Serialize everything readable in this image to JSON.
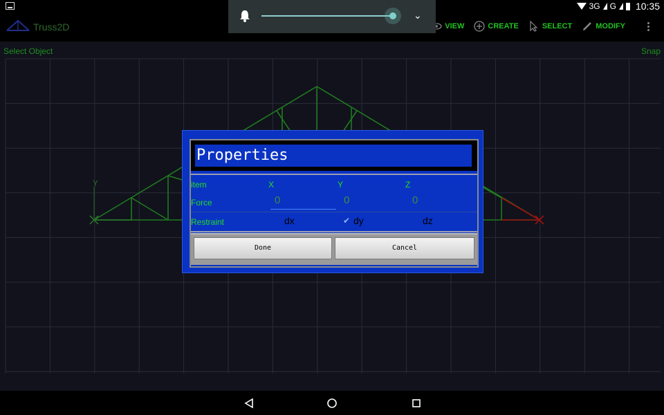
{
  "statusbar": {
    "network": "3G",
    "network2": "G",
    "time": "10:35"
  },
  "app": {
    "title": "Truss2D"
  },
  "menu": [
    {
      "icon": "eye-icon",
      "label": "VIEW"
    },
    {
      "icon": "plus-circle-icon",
      "label": "CREATE"
    },
    {
      "icon": "cursor-icon",
      "label": "SELECT"
    },
    {
      "icon": "pencil-icon",
      "label": "MODIFY"
    }
  ],
  "volume": {
    "level": 0.9
  },
  "canvas": {
    "status_left": "Select Object",
    "status_right": "Snap",
    "axis_y_label": "Y"
  },
  "dialog": {
    "title": "Properties",
    "header": {
      "label": "item",
      "x": "X",
      "y": "Y",
      "z": "Z"
    },
    "force": {
      "label": "Force",
      "x": "0",
      "y": "0",
      "z": "0"
    },
    "restraint": {
      "label": "Restraint",
      "dx": {
        "label": "dx",
        "checked": false
      },
      "dy": {
        "label": "dy",
        "checked": true
      },
      "dz": {
        "label": "dz",
        "checked": false
      }
    },
    "done_label": "Done",
    "cancel_label": "Cancel"
  },
  "colors": {
    "accent_green": "#22c022",
    "dialog_blue": "#0a33c4",
    "truss_green": "#1f8a1f",
    "axis_red": "#b01010"
  }
}
